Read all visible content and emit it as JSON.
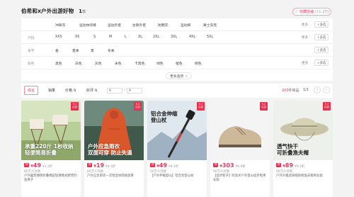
{
  "header": {
    "title": "伯希和x户外出游好物",
    "count": "1",
    "count_unit": "款",
    "fav_label": "收藏店铺",
    "fav_count": "(11.2万)"
  },
  "filters": {
    "rows": [
      {
        "label": "",
        "options": [
          "冲锋衣",
          "运动休闲裤",
          "运动外套",
          "女款外套",
          "防晒衣",
          "运动裤",
          "男士夹克"
        ]
      },
      {
        "label": "尺码",
        "options": [
          "XXS",
          "XS",
          "S",
          "M",
          "L",
          "XL",
          "2XL",
          "3XL",
          "4XL",
          "5XL"
        ]
      },
      {
        "label": "季节",
        "options": [
          "春",
          "夏季",
          "夏",
          "冬季"
        ]
      },
      {
        "label": "颜色",
        "options": [
          "黑色",
          "白色",
          "灰色",
          "米色",
          "卡其色",
          "绿色",
          "橙色",
          "棕色"
        ]
      }
    ],
    "more_label": "更多",
    "multi_label": "+多选",
    "more_options_label": "更多选项"
  },
  "toolbar": {
    "sort_default": "综合",
    "sort_sales": "销量",
    "sort_price": "价格",
    "sort_credit": "好评",
    "price_min": "¥",
    "price_max": "¥",
    "result_count": "200",
    "result_unit": "件商品",
    "page": "1/1",
    "prev": "‹",
    "next": "›"
  },
  "products": [
    {
      "img_text": "承重220斤 1秒收纳\n轻便简易折叠",
      "tag": "券",
      "price_symbol": "¥",
      "price": "49",
      "original": "¥1.1折",
      "paid": "60万人付款",
      "desc": "户外露营便携折叠椅超轻便携式野营钓鱼凳子",
      "badge": "5.2\n以旧"
    },
    {
      "img_text": "户外应急雨衣\n双面可穿 防止失温",
      "tag": "券",
      "price_symbol": "¥",
      "price": "19",
      "original": "¥4.1折",
      "paid": "60万人付款",
      "desc": "户外应急雨衣一次性连体雨披加厚",
      "badge": "5.2\n以旧"
    },
    {
      "img_text": "铝合金伸缩\n登山杖",
      "tag": "券",
      "price_symbol": "¥",
      "price": "49",
      "original": "¥4.1折",
      "paid": "60万人付款",
      "desc": "【户外伸缩登山】铝合金登山杖",
      "badge": "5.2\n以旧"
    },
    {
      "img_text": "",
      "tag": "券",
      "price_symbol": "¥",
      "price": "303",
      "original": "¥6.8折",
      "paid": "60万人付款",
      "desc": "【徒步鞋子】防泼水户外登山徒步鞋男女款",
      "badge": "5.2\n以旧"
    },
    {
      "img_text": "透气快干\n可折叠渔夫帽",
      "tag": "券",
      "price_symbol": "¥",
      "price": "89",
      "original": "¥9.1折",
      "paid": "60万人付款",
      "desc": "户外大檐遮阳帽防晒渔夫帽男女款",
      "badge": "5.2\n以旧"
    }
  ]
}
